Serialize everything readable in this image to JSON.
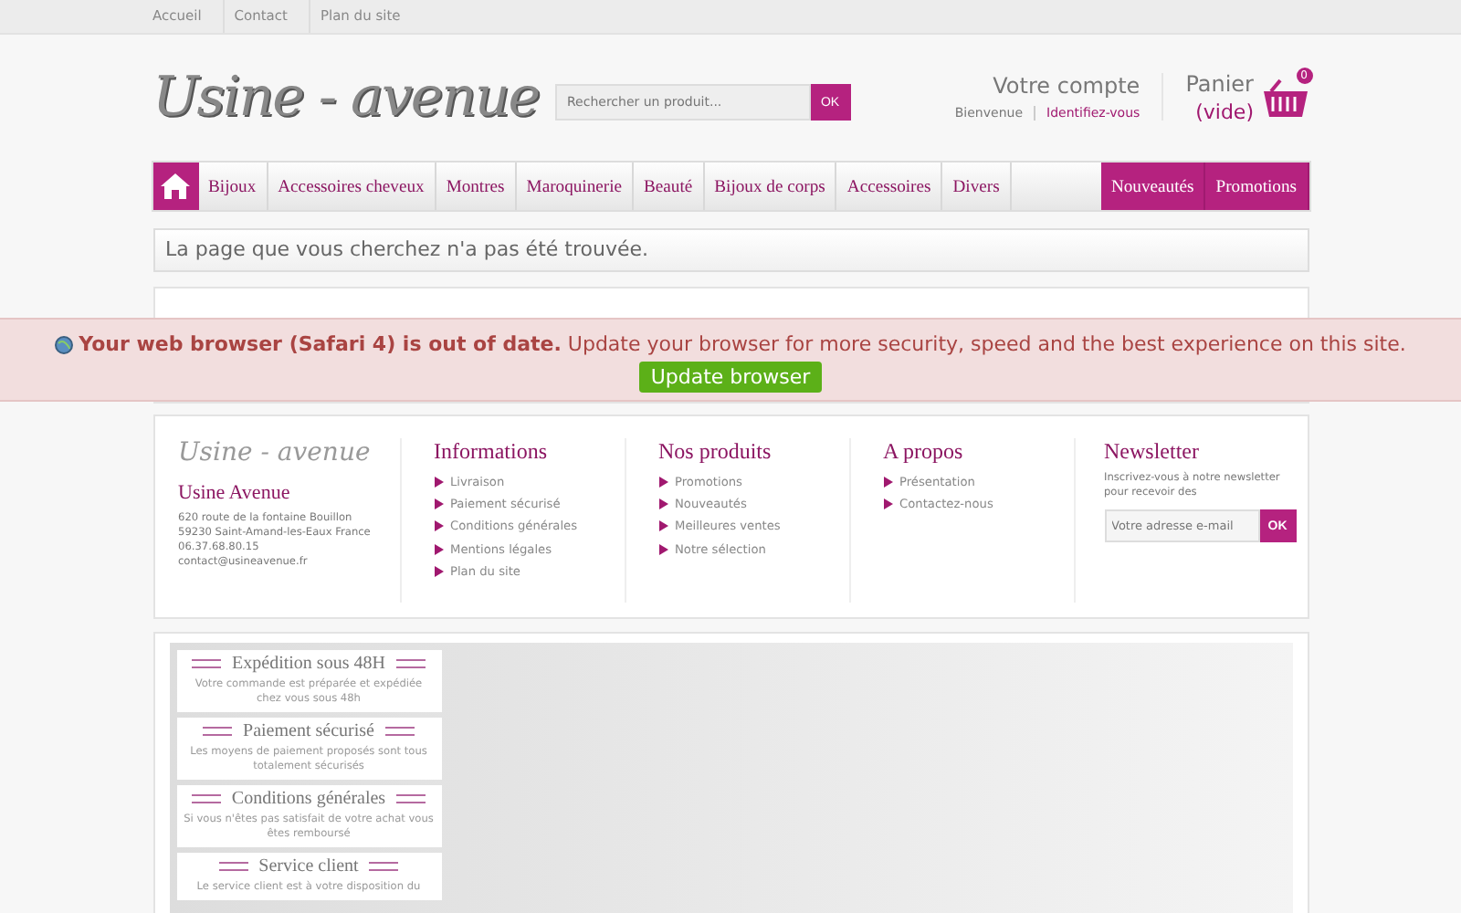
{
  "top_links": [
    "Accueil",
    "Contact",
    "Plan du site"
  ],
  "logo": "Usine - avenue",
  "search": {
    "placeholder": "Rechercher un produit...",
    "button": "OK"
  },
  "account": {
    "title": "Votre compte",
    "welcome": "Bienvenue",
    "login": "Identifiez-vous"
  },
  "cart": {
    "title": "Panier",
    "status": "(vide)",
    "count": "0"
  },
  "nav": [
    {
      "label": "Bijoux",
      "kind": "normal"
    },
    {
      "label": "Accessoires cheveux",
      "kind": "normal"
    },
    {
      "label": "Montres",
      "kind": "normal"
    },
    {
      "label": "Maroquinerie",
      "kind": "normal"
    },
    {
      "label": "Beauté",
      "kind": "normal"
    },
    {
      "label": "Bijoux de corps",
      "kind": "normal"
    },
    {
      "label": "Accessoires",
      "kind": "normal"
    },
    {
      "label": "Divers",
      "kind": "normal"
    },
    {
      "label": "Nouveautés",
      "kind": "highlight"
    },
    {
      "label": "Promotions",
      "kind": "highlight"
    }
  ],
  "notice": "La page que vous cherchez n'a pas été trouvée.",
  "browser_warning": {
    "message": "**Your web browser (Safari 4) is out of date.** Update your browser for more security, speed and the best experience on this site.",
    "button": "Update browser"
  },
  "footer": {
    "logo": "Usine - avenue",
    "company": "Usine Avenue",
    "address": [
      "620 route de la fontaine Bouillon",
      "59230 Saint-Amand-les-Eaux France",
      "06.37.68.80.15",
      "contact@usineavenue.fr"
    ],
    "columns": [
      {
        "title": "Informations",
        "links": [
          "Livraison",
          "Paiement sécurisé",
          "Conditions générales",
          "Mentions légales",
          "Plan du site"
        ]
      },
      {
        "title": "Nos produits",
        "links": [
          "Promotions",
          "Nouveautés",
          "Meilleures ventes",
          "Notre sélection"
        ]
      },
      {
        "title": "A propos",
        "links": [
          "Présentation",
          "Contactez-nous"
        ]
      }
    ],
    "newsletter": {
      "title": "Newsletter",
      "text": "Inscrivez-vous à notre newsletter pour recevoir des",
      "placeholder": "Votre adresse e-mail",
      "button": "OK"
    }
  },
  "features": [
    {
      "title": "Expédition sous 48H",
      "text": "Votre commande est préparée et expédiée chez vous sous 48h"
    },
    {
      "title": "Paiement sécurisé",
      "text": "Les moyens de paiement proposés sont tous totalement sécurisés"
    },
    {
      "title": "Conditions générales",
      "text": "Si vous n'êtes pas satisfait de votre achat vous êtes remboursé"
    },
    {
      "title": "Service client",
      "text": "Le service client est à votre disposition du"
    }
  ]
}
